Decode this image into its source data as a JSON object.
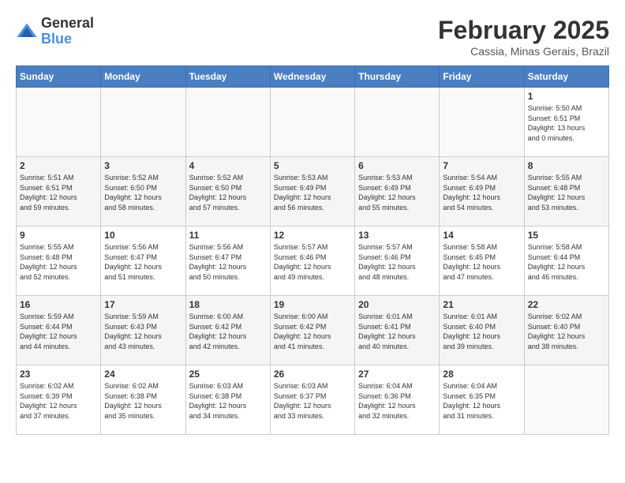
{
  "header": {
    "logo_general": "General",
    "logo_blue": "Blue",
    "month_title": "February 2025",
    "location": "Cassia, Minas Gerais, Brazil"
  },
  "days_of_week": [
    "Sunday",
    "Monday",
    "Tuesday",
    "Wednesday",
    "Thursday",
    "Friday",
    "Saturday"
  ],
  "weeks": [
    [
      {
        "day": "",
        "info": ""
      },
      {
        "day": "",
        "info": ""
      },
      {
        "day": "",
        "info": ""
      },
      {
        "day": "",
        "info": ""
      },
      {
        "day": "",
        "info": ""
      },
      {
        "day": "",
        "info": ""
      },
      {
        "day": "1",
        "info": "Sunrise: 5:50 AM\nSunset: 6:51 PM\nDaylight: 13 hours\nand 0 minutes."
      }
    ],
    [
      {
        "day": "2",
        "info": "Sunrise: 5:51 AM\nSunset: 6:51 PM\nDaylight: 12 hours\nand 59 minutes."
      },
      {
        "day": "3",
        "info": "Sunrise: 5:52 AM\nSunset: 6:50 PM\nDaylight: 12 hours\nand 58 minutes."
      },
      {
        "day": "4",
        "info": "Sunrise: 5:52 AM\nSunset: 6:50 PM\nDaylight: 12 hours\nand 57 minutes."
      },
      {
        "day": "5",
        "info": "Sunrise: 5:53 AM\nSunset: 6:49 PM\nDaylight: 12 hours\nand 56 minutes."
      },
      {
        "day": "6",
        "info": "Sunrise: 5:53 AM\nSunset: 6:49 PM\nDaylight: 12 hours\nand 55 minutes."
      },
      {
        "day": "7",
        "info": "Sunrise: 5:54 AM\nSunset: 6:49 PM\nDaylight: 12 hours\nand 54 minutes."
      },
      {
        "day": "8",
        "info": "Sunrise: 5:55 AM\nSunset: 6:48 PM\nDaylight: 12 hours\nand 53 minutes."
      }
    ],
    [
      {
        "day": "9",
        "info": "Sunrise: 5:55 AM\nSunset: 6:48 PM\nDaylight: 12 hours\nand 52 minutes."
      },
      {
        "day": "10",
        "info": "Sunrise: 5:56 AM\nSunset: 6:47 PM\nDaylight: 12 hours\nand 51 minutes."
      },
      {
        "day": "11",
        "info": "Sunrise: 5:56 AM\nSunset: 6:47 PM\nDaylight: 12 hours\nand 50 minutes."
      },
      {
        "day": "12",
        "info": "Sunrise: 5:57 AM\nSunset: 6:46 PM\nDaylight: 12 hours\nand 49 minutes."
      },
      {
        "day": "13",
        "info": "Sunrise: 5:57 AM\nSunset: 6:46 PM\nDaylight: 12 hours\nand 48 minutes."
      },
      {
        "day": "14",
        "info": "Sunrise: 5:58 AM\nSunset: 6:45 PM\nDaylight: 12 hours\nand 47 minutes."
      },
      {
        "day": "15",
        "info": "Sunrise: 5:58 AM\nSunset: 6:44 PM\nDaylight: 12 hours\nand 46 minutes."
      }
    ],
    [
      {
        "day": "16",
        "info": "Sunrise: 5:59 AM\nSunset: 6:44 PM\nDaylight: 12 hours\nand 44 minutes."
      },
      {
        "day": "17",
        "info": "Sunrise: 5:59 AM\nSunset: 6:43 PM\nDaylight: 12 hours\nand 43 minutes."
      },
      {
        "day": "18",
        "info": "Sunrise: 6:00 AM\nSunset: 6:42 PM\nDaylight: 12 hours\nand 42 minutes."
      },
      {
        "day": "19",
        "info": "Sunrise: 6:00 AM\nSunset: 6:42 PM\nDaylight: 12 hours\nand 41 minutes."
      },
      {
        "day": "20",
        "info": "Sunrise: 6:01 AM\nSunset: 6:41 PM\nDaylight: 12 hours\nand 40 minutes."
      },
      {
        "day": "21",
        "info": "Sunrise: 6:01 AM\nSunset: 6:40 PM\nDaylight: 12 hours\nand 39 minutes."
      },
      {
        "day": "22",
        "info": "Sunrise: 6:02 AM\nSunset: 6:40 PM\nDaylight: 12 hours\nand 38 minutes."
      }
    ],
    [
      {
        "day": "23",
        "info": "Sunrise: 6:02 AM\nSunset: 6:39 PM\nDaylight: 12 hours\nand 37 minutes."
      },
      {
        "day": "24",
        "info": "Sunrise: 6:02 AM\nSunset: 6:38 PM\nDaylight: 12 hours\nand 35 minutes."
      },
      {
        "day": "25",
        "info": "Sunrise: 6:03 AM\nSunset: 6:38 PM\nDaylight: 12 hours\nand 34 minutes."
      },
      {
        "day": "26",
        "info": "Sunrise: 6:03 AM\nSunset: 6:37 PM\nDaylight: 12 hours\nand 33 minutes."
      },
      {
        "day": "27",
        "info": "Sunrise: 6:04 AM\nSunset: 6:36 PM\nDaylight: 12 hours\nand 32 minutes."
      },
      {
        "day": "28",
        "info": "Sunrise: 6:04 AM\nSunset: 6:35 PM\nDaylight: 12 hours\nand 31 minutes."
      },
      {
        "day": "",
        "info": ""
      }
    ]
  ]
}
